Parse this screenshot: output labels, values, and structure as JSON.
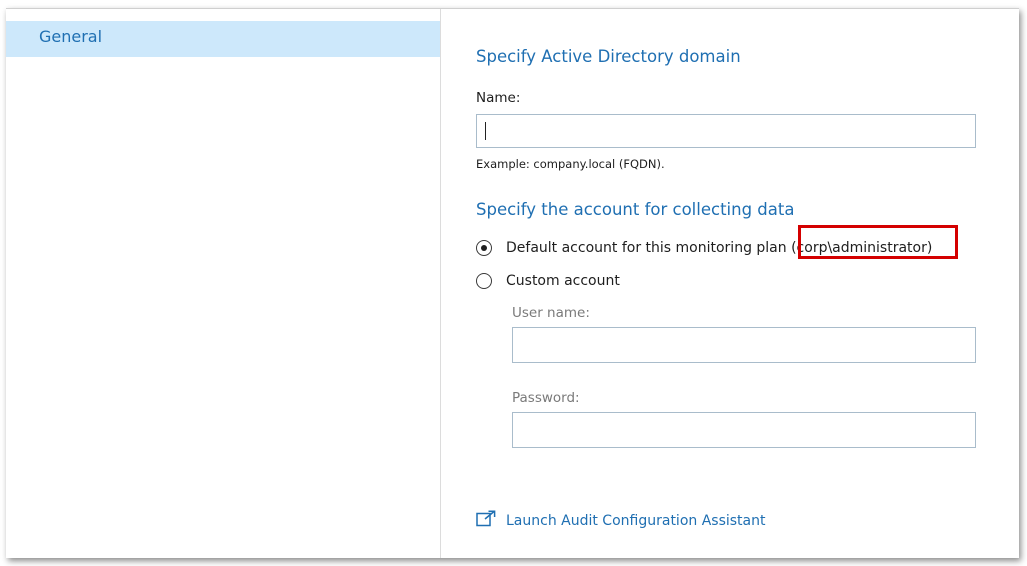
{
  "sidebar": {
    "items": [
      {
        "label": "General",
        "selected": true
      }
    ]
  },
  "domain": {
    "title": "Specify Active Directory domain",
    "name_label": "Name:",
    "name_value": "",
    "example_hint": "Example: company.local (FQDN)."
  },
  "account": {
    "title": "Specify the account for collecting data",
    "default_option_label": "Default account for this monitoring plan",
    "default_account": "(corp\\administrator)",
    "custom_option_label": "Custom account",
    "selected": "default",
    "username_label": "User name:",
    "username_value": "",
    "password_label": "Password:",
    "password_value": ""
  },
  "links": {
    "launch_label": "Launch Audit Configuration Assistant",
    "launch_icon": "external-link-icon"
  },
  "colors": {
    "accent": "#1f6fb2",
    "selected_bg": "#cde8fb",
    "highlight": "#d40000"
  }
}
